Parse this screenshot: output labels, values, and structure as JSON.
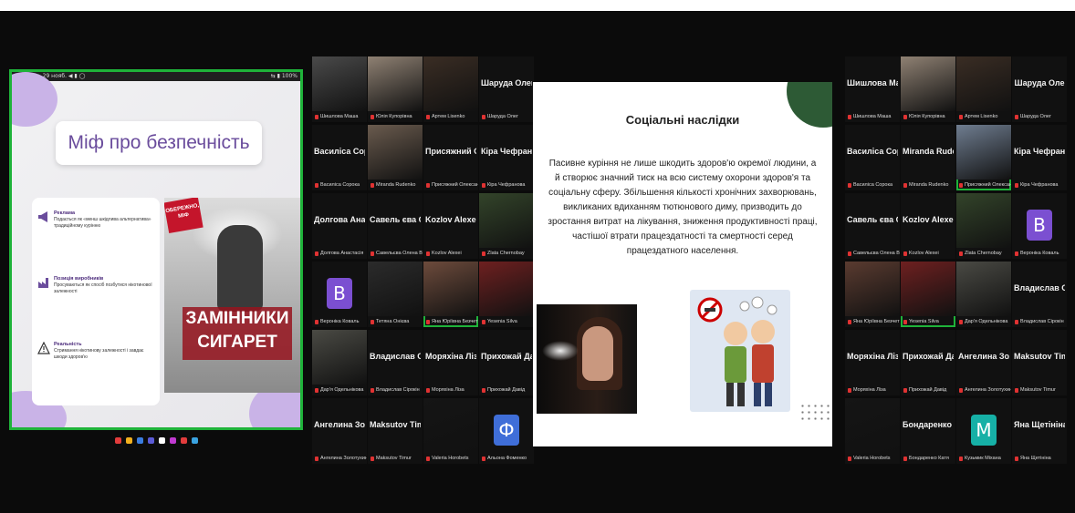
{
  "left_screen": {
    "status_left": "12:50  Чт, 29 нояб.  ◀ ▮ ◯",
    "status_right": "⇆ ▮ 100%",
    "title": "Міф про безпечність",
    "items": [
      {
        "heading": "Реклама",
        "text": "Подається як «менш шкідлива альтернатива» традиційному курінню",
        "icon": "megaphone-icon"
      },
      {
        "heading": "Позиція виробників",
        "text": "Просуваються як спосіб позбутися нікотинової залежності",
        "icon": "factory-icon"
      },
      {
        "heading": "Реальність",
        "text": "Стримання нікотинову залежності і завдає шкоди здоров'ю",
        "icon": "warning-icon"
      }
    ],
    "stamp": "ОБЕРЕЖНО, МІФ",
    "banner": "ЗАМІННИКИ СИГАРЕТ",
    "taskbar_colors": [
      "#e23c3c",
      "#f2b01e",
      "#3a7de0",
      "#5b5bd6",
      "#ffffff",
      "#c03ad1",
      "#e23c3c",
      "#3aa3e0"
    ]
  },
  "left_grid": [
    {
      "name": "Шишлова Маша",
      "bg": "#4a4a4a"
    },
    {
      "name": "Юлія Купорівна",
      "bg": "#8f8173"
    },
    {
      "name": "Артем Lisenko",
      "bg": "#3a2d24"
    },
    {
      "name": "Шаруда Олег",
      "big": "Шаруда Олег"
    },
    {
      "name": "Василіса Сорока",
      "big": "Василіса Сорока"
    },
    {
      "name": "Miranda Rudenko",
      "bg": "#6a5b4e"
    },
    {
      "name": "Присяжний Олександр",
      "big": "Присяжний Ол..."
    },
    {
      "name": "Кіра Чефранова",
      "big": "Кіра Чефранова"
    },
    {
      "name": "Долгова Анастасія",
      "big": "Долгова Анаст..."
    },
    {
      "name": "Савельєва Олена Вале...",
      "big": "Савель єва Оле..."
    },
    {
      "name": "Kozlov Alexei",
      "big": "Kozlov Alexei"
    },
    {
      "name": "Zlata Chernobay",
      "bg": "#33442a"
    },
    {
      "name": "Вероніка Коваль",
      "avatar": "B",
      "avatar_color": "#7b4fd1"
    },
    {
      "name": "Тетяна Онієва",
      "bg": "#2b2b2b"
    },
    {
      "name": "Яна Юріївна Безчетнікова",
      "bg": "#6d4b3c",
      "active": true
    },
    {
      "name": "Yesenia Silva",
      "bg": "#6e2020"
    },
    {
      "name": "Дар'я Одельнікова",
      "bg": "#4a4a44"
    },
    {
      "name": "Владислав Сірокін",
      "big": "Владислав Сір..."
    },
    {
      "name": "Моряхіна Ліза",
      "big": "Моряхіна Ліза"
    },
    {
      "name": "Прихожай Давід",
      "big": "Прихожай Давід"
    },
    {
      "name": "Ангелина Золотухина",
      "big": "Ангелина Золо..."
    },
    {
      "name": "Maksutov Timur",
      "big": "Maksutov Timur"
    },
    {
      "name": "Valeria Horobets",
      "bg": "#151515"
    },
    {
      "name": "Альона Фоменко",
      "avatar": "Ф",
      "avatar_color": "#3f6ed8"
    }
  ],
  "right_slide": {
    "title": "Соціальні наслідки",
    "body": "Пасивне куріння не лише шкодить здоров'ю окремої людини, а й створює значний тиск на всю систему охорони здоров'я та соціальну сферу. Збільшення кількості хронічних захворювань, викликаних вдиханням тютюнового диму, призводить до зростання витрат на лікування, зниження продуктивності праці, частішої втрати працездатності та смертності серед працездатного населення."
  },
  "right_grid": [
    {
      "name": "Шишлова Маша",
      "big": "Шишлова Маша"
    },
    {
      "name": "Юлія Купорівна",
      "bg": "#8f8173"
    },
    {
      "name": "Артем Lisenko",
      "bg": "#3a2d24"
    },
    {
      "name": "Шаруда Олег",
      "big": "Шаруда Оле"
    },
    {
      "name": "Василіса Сорока",
      "big": "Василіса Сорока"
    },
    {
      "name": "Miranda Rudenko",
      "big": "Miranda Rudenko"
    },
    {
      "name": "Присяжний Олександр",
      "bg": "#6f7d90",
      "active": true
    },
    {
      "name": "Кіра Чефранова",
      "big": "Кіра Чефранс"
    },
    {
      "name": "Савельєва Олена Вале...",
      "big": "Савель єва Оле..."
    },
    {
      "name": "Kozlov Alexei",
      "big": "Kozlov Alexei"
    },
    {
      "name": "Zlata Chernobay",
      "bg": "#33442a"
    },
    {
      "name": "Вероніка Коваль",
      "avatar": "B",
      "avatar_color": "#7b4fd1"
    },
    {
      "name": "Яна Юріївна Безчетні...",
      "bg": "#5a3b30"
    },
    {
      "name": "Yesenia Silva",
      "bg": "#6e2020",
      "active": true
    },
    {
      "name": "Дар'я Одельнікова",
      "bg": "#4a4a44"
    },
    {
      "name": "Владислав Сірокін",
      "big": "Владислав Сі"
    },
    {
      "name": "Моряхіна Ліза",
      "big": "Моряхіна Ліза"
    },
    {
      "name": "Прихожай Давід",
      "big": "Прихожай Давід"
    },
    {
      "name": "Ангелина Золотухина",
      "big": "Ангелина Золо..."
    },
    {
      "name": "Maksutov Timur",
      "big": "Maksutov Tim"
    },
    {
      "name": "Valeria Horobets",
      "bg": "#151515"
    },
    {
      "name": "Бондаренко Катя",
      "big": "Бондаренко Катя"
    },
    {
      "name": "Кузьмик Міхана",
      "avatar": "M",
      "avatar_color": "#16b0a6"
    },
    {
      "name": "Яна Щетініна",
      "big": "Яна Щетініна"
    }
  ]
}
